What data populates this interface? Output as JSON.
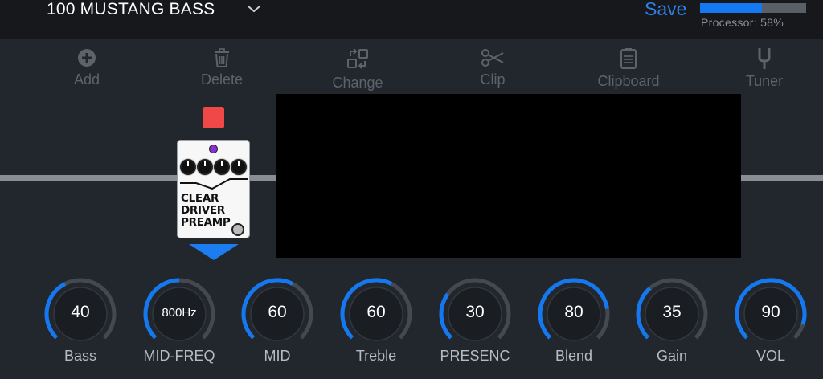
{
  "header": {
    "preset_name": "100 MUSTANG BASS",
    "save_label": "Save",
    "processor_label": "Processor: 58%",
    "processor_fraction": 0.58,
    "accent_color": "#2e7fe6"
  },
  "toolbar": {
    "add_label": "Add",
    "delete_label": "Delete",
    "change_label": "Change",
    "clip_label": "Clip",
    "clipboard_label": "Clipboard",
    "tuner_label": "Tuner"
  },
  "pedal": {
    "name_line1": "CLEAR",
    "name_line2": "DRIVER",
    "name_line3": "PREAMP",
    "led_color": "#f04848"
  },
  "knobs": [
    {
      "label": "Bass",
      "value": "40",
      "fraction": 0.4
    },
    {
      "label": "MID-FREQ",
      "value": "800Hz",
      "fraction": 0.5
    },
    {
      "label": "MID",
      "value": "60",
      "fraction": 0.6
    },
    {
      "label": "Treble",
      "value": "60",
      "fraction": 0.6
    },
    {
      "label": "PRESENC",
      "value": "30",
      "fraction": 0.3
    },
    {
      "label": "Blend",
      "value": "80",
      "fraction": 0.8
    },
    {
      "label": "Gain",
      "value": "35",
      "fraction": 0.35
    },
    {
      "label": "VOL",
      "value": "90",
      "fraction": 0.9
    }
  ]
}
